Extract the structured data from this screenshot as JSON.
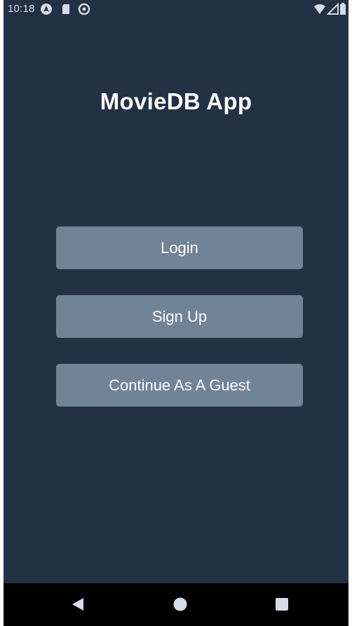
{
  "status_bar": {
    "time": "10:18",
    "left_icons": [
      "android-auto-icon",
      "sd-card-icon",
      "sync-icon"
    ],
    "right_icons": [
      "wifi-icon",
      "signal-icon",
      "battery-icon"
    ]
  },
  "app": {
    "title": "MovieDB App"
  },
  "buttons": {
    "login": "Login",
    "signup": "Sign Up",
    "guest": "Continue As A Guest"
  },
  "nav_bar": {
    "icons": [
      "back-icon",
      "home-icon",
      "recents-icon"
    ]
  },
  "colors": {
    "background": "#223143",
    "button": "#718396",
    "text": "#ffffff",
    "nav_bar": "#000000"
  }
}
